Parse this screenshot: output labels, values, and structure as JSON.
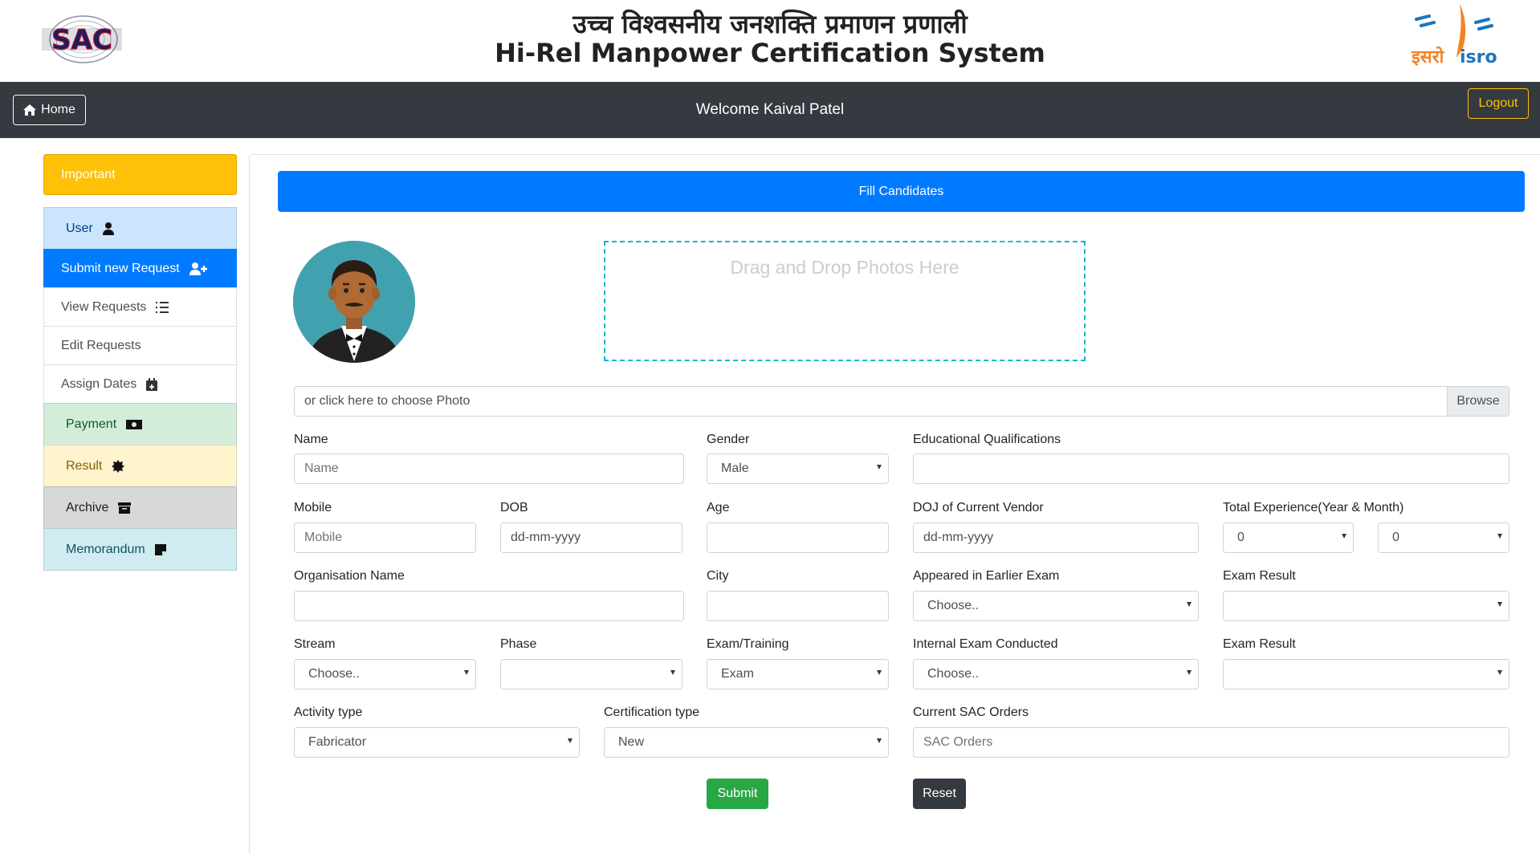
{
  "header": {
    "title_hindi": "उच्च विश्वसनीय जनशक्ति प्रमाणन प्रणाली",
    "title_english": "Hi-Rel Manpower Certification System",
    "left_logo_text": "SAC",
    "right_logo_text_hindi": "इसरो",
    "right_logo_text_english": "isro"
  },
  "navbar": {
    "home_label": "Home",
    "welcome": "Welcome Kaival Patel",
    "logout_label": "Logout"
  },
  "sidebar": {
    "important_label": "Important",
    "items": [
      {
        "label": "User",
        "icon": "user-icon"
      },
      {
        "label": "Submit new Request",
        "icon": "user-plus-icon"
      },
      {
        "label": "View Requests",
        "icon": "list-icon"
      },
      {
        "label": "Edit Requests",
        "icon": ""
      },
      {
        "label": "Assign Dates",
        "icon": "calendar-plus-icon"
      },
      {
        "label": "Payment",
        "icon": "money-bill-icon"
      },
      {
        "label": "Result",
        "icon": "certificate-icon"
      },
      {
        "label": "Archive",
        "icon": "archive-icon"
      },
      {
        "label": "Memorandum",
        "icon": "sticky-note-icon"
      }
    ]
  },
  "main": {
    "banner": "Fill Candidates",
    "dropzone_text": "Drag and Drop Photos Here",
    "file_label": "or click here to choose Photo",
    "browse_label": "Browse",
    "fields": {
      "name": {
        "label": "Name",
        "placeholder": "Name"
      },
      "gender": {
        "label": "Gender",
        "value": "Male"
      },
      "edu": {
        "label": "Educational Qualifications",
        "value": ""
      },
      "mobile": {
        "label": "Mobile",
        "placeholder": "Mobile"
      },
      "dob": {
        "label": "DOB",
        "placeholder": "dd-mm-yyyy"
      },
      "age": {
        "label": "Age",
        "value": ""
      },
      "doj": {
        "label": "DOJ of Current Vendor",
        "placeholder": "dd-mm-yyyy"
      },
      "total_exp": {
        "label": "Total Experience(Year & Month)",
        "years": "0",
        "months": "0"
      },
      "org": {
        "label": "Organisation Name",
        "value": ""
      },
      "city": {
        "label": "City",
        "value": ""
      },
      "appeared": {
        "label": "Appeared in Earlier Exam",
        "value": "Choose.."
      },
      "exam_result_1": {
        "label": "Exam Result",
        "value": ""
      },
      "stream": {
        "label": "Stream",
        "value": "Choose.."
      },
      "phase": {
        "label": "Phase",
        "value": ""
      },
      "exam_training": {
        "label": "Exam/Training",
        "value": "Exam"
      },
      "internal_exam": {
        "label": "Internal Exam Conducted",
        "value": "Choose.."
      },
      "exam_result_2": {
        "label": "Exam Result",
        "value": ""
      },
      "activity": {
        "label": "Activity type",
        "value": "Fabricator"
      },
      "cert_type": {
        "label": "Certification type",
        "value": "New"
      },
      "sac_orders": {
        "label": "Current SAC Orders",
        "placeholder": "SAC Orders"
      }
    },
    "submit_label": "Submit",
    "reset_label": "Reset"
  },
  "colors": {
    "navbar": "#343a40",
    "primary": "#007bff",
    "warning": "#ffc107",
    "success": "#28a745",
    "dropzone_border": "#17b4d0"
  }
}
